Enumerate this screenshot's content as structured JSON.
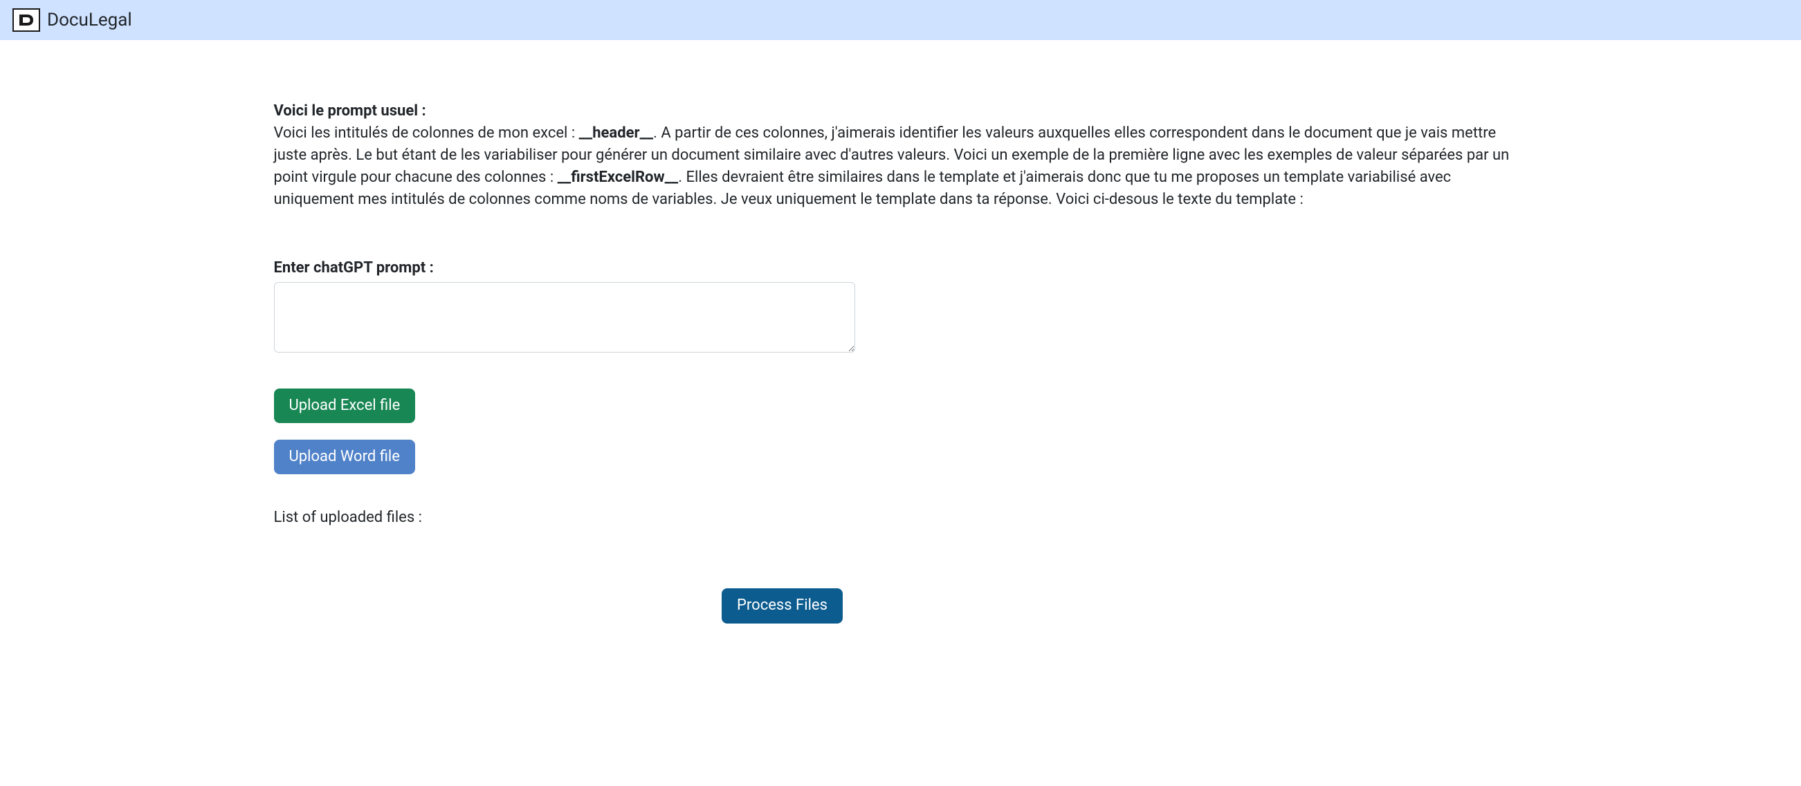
{
  "header": {
    "app_title": "DocuLegal"
  },
  "prompt": {
    "heading": "Voici le prompt usuel :",
    "text_part1": "Voici les intitulés de colonnes de mon excel : ",
    "var1": "__header__",
    "text_part2": ". A partir de ces colonnes, j'aimerais identifier les valeurs auxquelles elles correspondent dans le document que je vais mettre juste après. Le but étant de les variabiliser pour générer un document similaire avec d'autres valeurs. Voici un exemple de la première ligne avec les exemples de valeur séparées par un point virgule pour chacune des colonnes : ",
    "var2": "__firstExcelRow__",
    "text_part3": ". Elles devraient être similaires dans le template et j'aimerais donc que tu me proposes un template variabilisé avec uniquement mes intitulés de colonnes comme noms de variables. Je veux uniquement le template dans ta réponse. Voici ci-desous le texte du template :"
  },
  "form": {
    "textarea_label": "Enter chatGPT prompt :",
    "textarea_value": ""
  },
  "buttons": {
    "upload_excel": "Upload Excel file",
    "upload_word": "Upload Word file",
    "process": "Process Files"
  },
  "files": {
    "list_label": "List of uploaded files :"
  }
}
